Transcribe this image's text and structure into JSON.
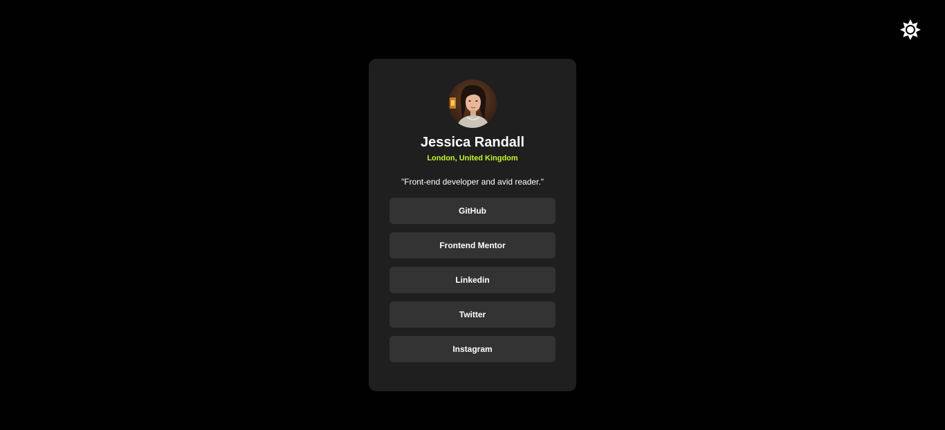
{
  "profile": {
    "name": "Jessica Randall",
    "location": "London, United Kingdom",
    "bio": "\"Front-end developer and avid reader.\"",
    "avatar_icon": "profile-photo"
  },
  "links": [
    {
      "label": "GitHub"
    },
    {
      "label": "Frontend Mentor"
    },
    {
      "label": "Linkedin"
    },
    {
      "label": "Twitter"
    },
    {
      "label": "Instagram"
    }
  ],
  "theme_toggle": {
    "icon": "sun-icon"
  },
  "colors": {
    "background": "#010101",
    "card": "#1f1f1f",
    "button": "#333333",
    "accent": "#c4f82a",
    "text": "#ffffff"
  }
}
